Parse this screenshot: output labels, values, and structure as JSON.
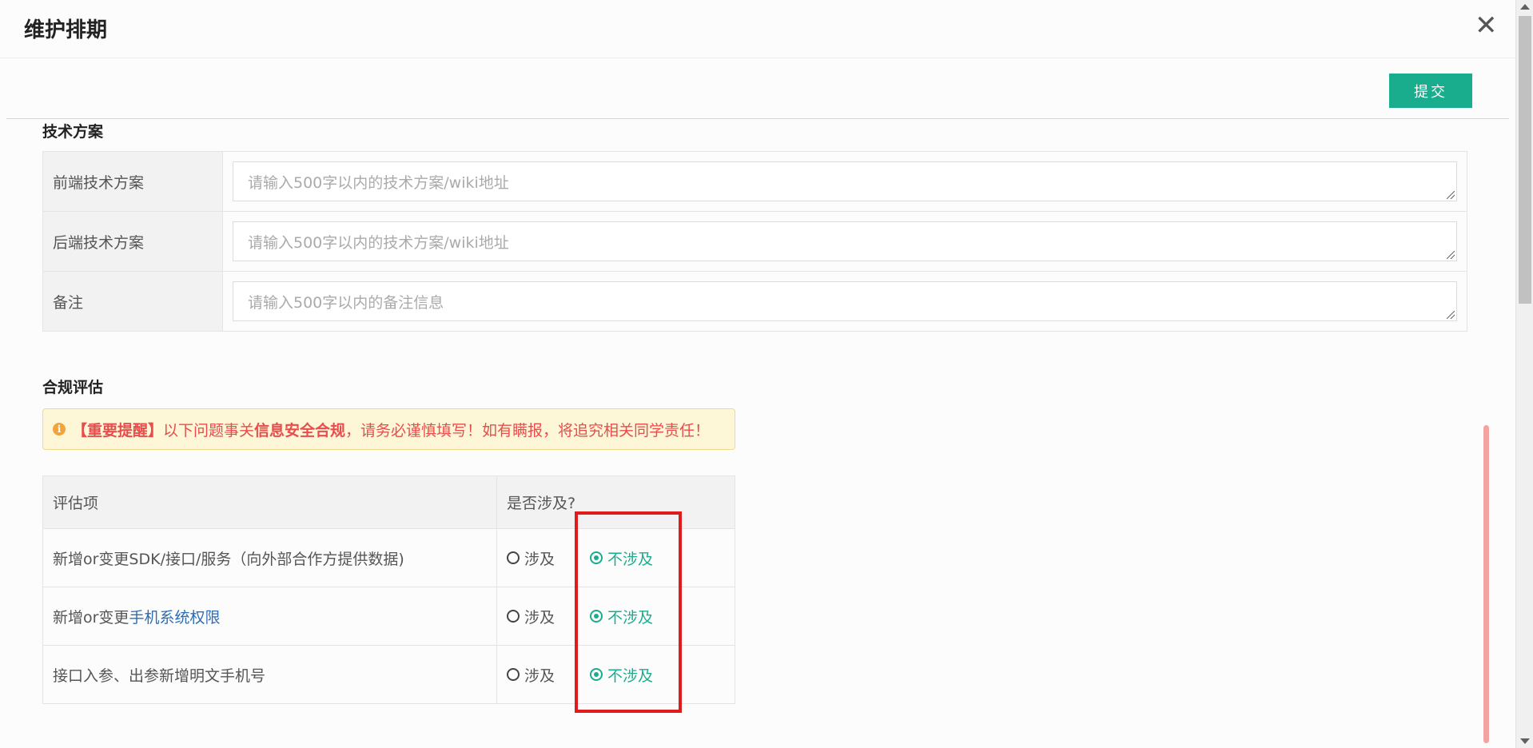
{
  "dialog": {
    "title": "维护排期",
    "close_glyph": "✕",
    "submit_label": "提交"
  },
  "tech": {
    "section_title": "技术方案",
    "rows": [
      {
        "label": "前端技术方案",
        "placeholder": "请输入500字以内的技术方案/wiki地址"
      },
      {
        "label": "后端技术方案",
        "placeholder": "请输入500字以内的技术方案/wiki地址"
      },
      {
        "label": "备注",
        "placeholder": "请输入500字以内的备注信息"
      }
    ]
  },
  "compliance": {
    "section_title": "合规评估",
    "warning": {
      "icon": "info-icon",
      "emph_prefix": "【重要提醒】",
      "text_a": "以下问题事关",
      "emph_mid": "信息安全合规",
      "text_b": "，请务必谨慎填写！如有瞒报，将追究相关同学责任！"
    },
    "headers": {
      "item": "评估项",
      "involved": "是否涉及?"
    },
    "option_yes": "涉及",
    "option_no": "不涉及",
    "rows": [
      {
        "text": "新增or变更SDK/接口/服务（向外部合作方提供数据)",
        "link": "",
        "selected": "不涉及"
      },
      {
        "text": "新增or变更",
        "link": "手机系统权限",
        "selected": "不涉及"
      },
      {
        "text": "接口入参、出参新增明文手机号",
        "link": "",
        "selected": "不涉及"
      }
    ]
  },
  "colors": {
    "primary": "#1aad8d",
    "warning_text": "#e94c4c",
    "warning_bg": "#fdf7d7",
    "link": "#2d6db3",
    "highlight": "#e01b1b"
  }
}
